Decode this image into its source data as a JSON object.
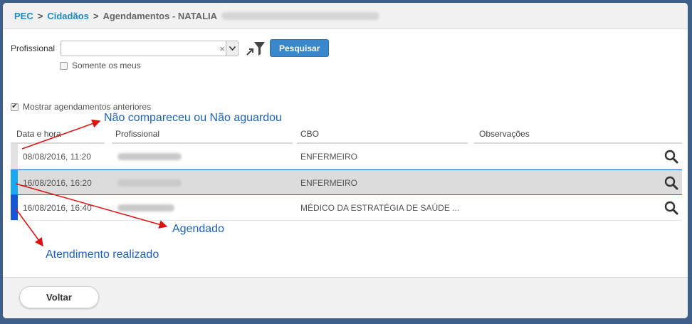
{
  "breadcrumb": {
    "root": "PEC",
    "sep1": ">",
    "citizens": "Cidadãos",
    "sep2": ">",
    "current": "Agendamentos - NATALIA"
  },
  "filter": {
    "professional_label": "Profissional",
    "professional_value": "",
    "clear_glyph": "×",
    "search_button": "Pesquisar",
    "only_mine_label": "Somente os meus",
    "show_previous_label": "Mostrar agendamentos anteriores",
    "show_previous_checked": true
  },
  "table": {
    "headers": {
      "datetime": "Data e hora",
      "professional": "Profissional",
      "cbo": "CBO",
      "notes": "Observações"
    },
    "rows": [
      {
        "datetime": "08/08/2016, 11:20",
        "cbo": "ENFERMEIRO",
        "notes": "",
        "status_color": "#e2e2e2"
      },
      {
        "datetime": "16/08/2016, 16:20",
        "cbo": "ENFERMEIRO",
        "notes": "",
        "status_color": "#18a8f0"
      },
      {
        "datetime": "16/08/2016, 16:40",
        "cbo": "MÉDICO DA ESTRATÉGIA DE SAÚDE ...",
        "notes": "",
        "status_color": "#1456d8"
      }
    ]
  },
  "annotations": {
    "no_show": "Não compareceu ou Não aguardou",
    "scheduled": "Agendado",
    "completed": "Atendimento realizado"
  },
  "footer": {
    "back_button": "Voltar"
  },
  "colors": {
    "accent": "#1a8ad0",
    "button": "#3a87cc",
    "annotation": "#1a63c5",
    "arrow": "#e01010"
  }
}
